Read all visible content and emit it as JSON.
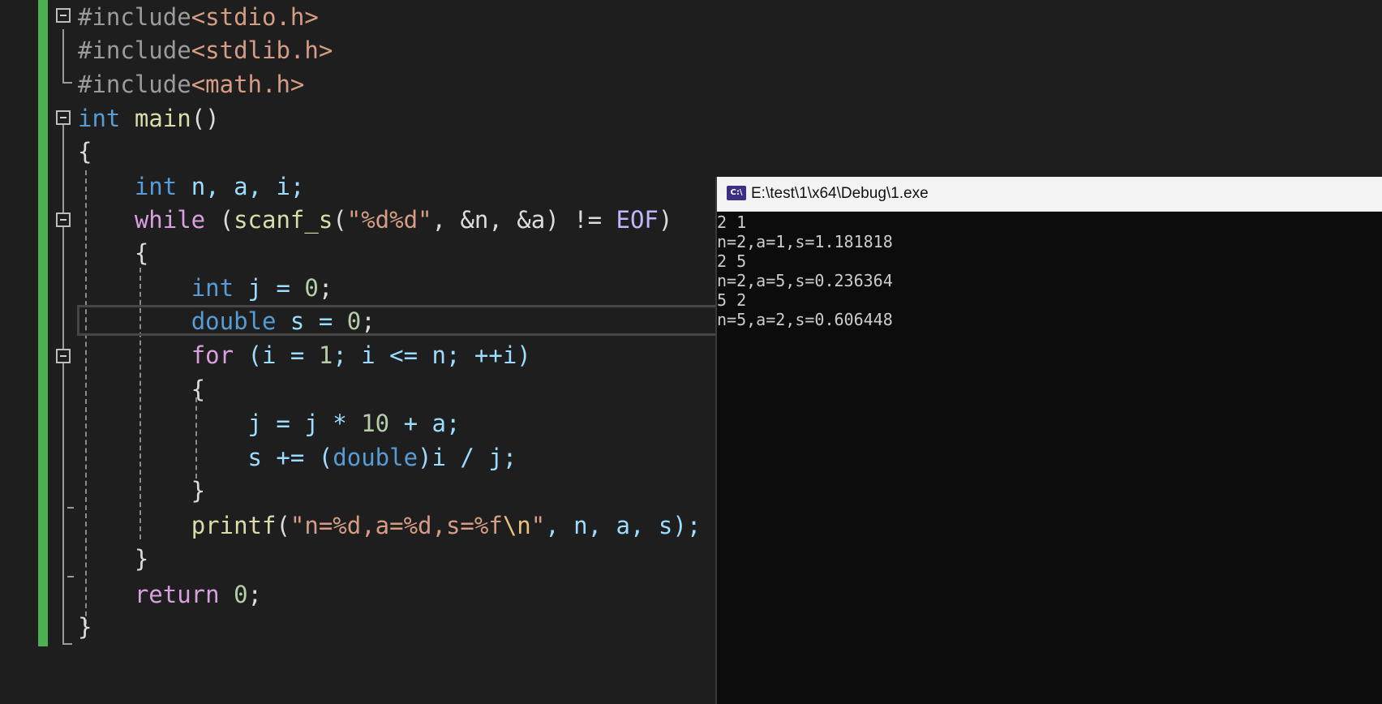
{
  "editor": {
    "lines": [
      [
        {
          "t": "#include",
          "c": "#9b9b9b"
        },
        {
          "t": "<stdio.h>",
          "c": "#d69d85"
        }
      ],
      [
        {
          "t": "#include",
          "c": "#9b9b9b"
        },
        {
          "t": "<stdlib.h>",
          "c": "#d69d85"
        }
      ],
      [
        {
          "t": "#include",
          "c": "#9b9b9b"
        },
        {
          "t": "<math.h>",
          "c": "#d69d85"
        }
      ],
      [
        {
          "t": "int",
          "c": "#569cd6"
        },
        {
          "t": " ",
          "c": "#dcdcdc"
        },
        {
          "t": "main",
          "c": "#dcdcaa"
        },
        {
          "t": "()",
          "c": "#dcdcdc"
        }
      ],
      [
        {
          "t": "{",
          "c": "#dcdcdc"
        }
      ],
      [
        {
          "t": "    ",
          "c": "#dcdcdc"
        },
        {
          "t": "int",
          "c": "#569cd6"
        },
        {
          "t": " n, a, i;",
          "c": "#9cdcfe"
        }
      ],
      [
        {
          "t": "    ",
          "c": "#dcdcdc"
        },
        {
          "t": "while",
          "c": "#d8a0df"
        },
        {
          "t": " (",
          "c": "#dcdcdc"
        },
        {
          "t": "scanf_s",
          "c": "#dcdcaa"
        },
        {
          "t": "(",
          "c": "#dcdcdc"
        },
        {
          "t": "\"%d%d\"",
          "c": "#d69d85"
        },
        {
          "t": ", &n, &a) != ",
          "c": "#dcdcdc"
        },
        {
          "t": "EOF",
          "c": "#beb7ff"
        },
        {
          "t": ")",
          "c": "#dcdcdc"
        }
      ],
      [
        {
          "t": "    {",
          "c": "#dcdcdc"
        }
      ],
      [
        {
          "t": "        ",
          "c": "#dcdcdc"
        },
        {
          "t": "int",
          "c": "#569cd6"
        },
        {
          "t": " j = ",
          "c": "#9cdcfe"
        },
        {
          "t": "0",
          "c": "#b5cea8"
        },
        {
          "t": ";",
          "c": "#dcdcdc"
        }
      ],
      [
        {
          "t": "        ",
          "c": "#dcdcdc"
        },
        {
          "t": "double",
          "c": "#569cd6"
        },
        {
          "t": " s = ",
          "c": "#9cdcfe"
        },
        {
          "t": "0",
          "c": "#b5cea8"
        },
        {
          "t": ";",
          "c": "#dcdcdc"
        }
      ],
      [
        {
          "t": "        ",
          "c": "#dcdcdc"
        },
        {
          "t": "for",
          "c": "#d8a0df"
        },
        {
          "t": " (i = ",
          "c": "#9cdcfe"
        },
        {
          "t": "1",
          "c": "#b5cea8"
        },
        {
          "t": "; i <= n; ++i)",
          "c": "#9cdcfe"
        }
      ],
      [
        {
          "t": "        {",
          "c": "#dcdcdc"
        }
      ],
      [
        {
          "t": "            j = j * ",
          "c": "#9cdcfe"
        },
        {
          "t": "10",
          "c": "#b5cea8"
        },
        {
          "t": " + a;",
          "c": "#9cdcfe"
        }
      ],
      [
        {
          "t": "            s += (",
          "c": "#9cdcfe"
        },
        {
          "t": "double",
          "c": "#569cd6"
        },
        {
          "t": ")i / j;",
          "c": "#9cdcfe"
        }
      ],
      [
        {
          "t": "        }",
          "c": "#dcdcdc"
        }
      ],
      [
        {
          "t": "        ",
          "c": "#dcdcdc"
        },
        {
          "t": "printf",
          "c": "#dcdcaa"
        },
        {
          "t": "(",
          "c": "#dcdcdc"
        },
        {
          "t": "\"n=%d,a=%d,s=%f",
          "c": "#d69d85"
        },
        {
          "t": "\\n",
          "c": "#e8c17a"
        },
        {
          "t": "\"",
          "c": "#d69d85"
        },
        {
          "t": ", n, a, s);",
          "c": "#9cdcfe"
        }
      ],
      [
        {
          "t": "    }",
          "c": "#dcdcdc"
        }
      ],
      [
        {
          "t": "    ",
          "c": "#dcdcdc"
        },
        {
          "t": "return",
          "c": "#d8a0df"
        },
        {
          "t": " ",
          "c": "#dcdcdc"
        },
        {
          "t": "0",
          "c": "#b5cea8"
        },
        {
          "t": ";",
          "c": "#dcdcdc"
        }
      ],
      [
        {
          "t": "}",
          "c": "#dcdcdc"
        }
      ]
    ]
  },
  "console": {
    "title": "E:\\test\\1\\x64\\Debug\\1.exe",
    "icon": "console-app-icon",
    "icon_label": "C:\\",
    "output": [
      "2 1",
      "n=2,a=1,s=1.181818",
      "2 5",
      "n=2,a=5,s=0.236364",
      "5 2",
      "n=5,a=2,s=0.606448"
    ]
  }
}
